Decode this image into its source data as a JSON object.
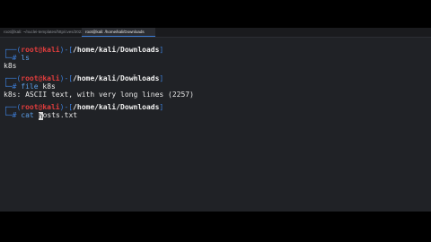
{
  "tabs": [
    {
      "label": "root@kali: ~/nuclei-templates/http/cves/2023"
    },
    {
      "label": "root@kali: /home/kali/Downloads"
    }
  ],
  "prompt": {
    "user": "root",
    "at": "@",
    "host": "kali",
    "cwd": "/home/kali/Downloads",
    "symbol": "#"
  },
  "blocks": [
    {
      "command": "ls",
      "argument": "",
      "output": "k8s"
    },
    {
      "command": "file",
      "argument": "k8s",
      "output": "k8s: ASCII text, with very long lines (2257)"
    },
    {
      "command": "cat",
      "argument_before_cursor": "",
      "argument_after_cursor": "osts.txt",
      "cursor_char": "h"
    }
  ],
  "colors": {
    "background": "#202226",
    "prompt_frame": "#3c7ed8",
    "user_host": "#e23d3d",
    "command": "#5b9de6"
  }
}
